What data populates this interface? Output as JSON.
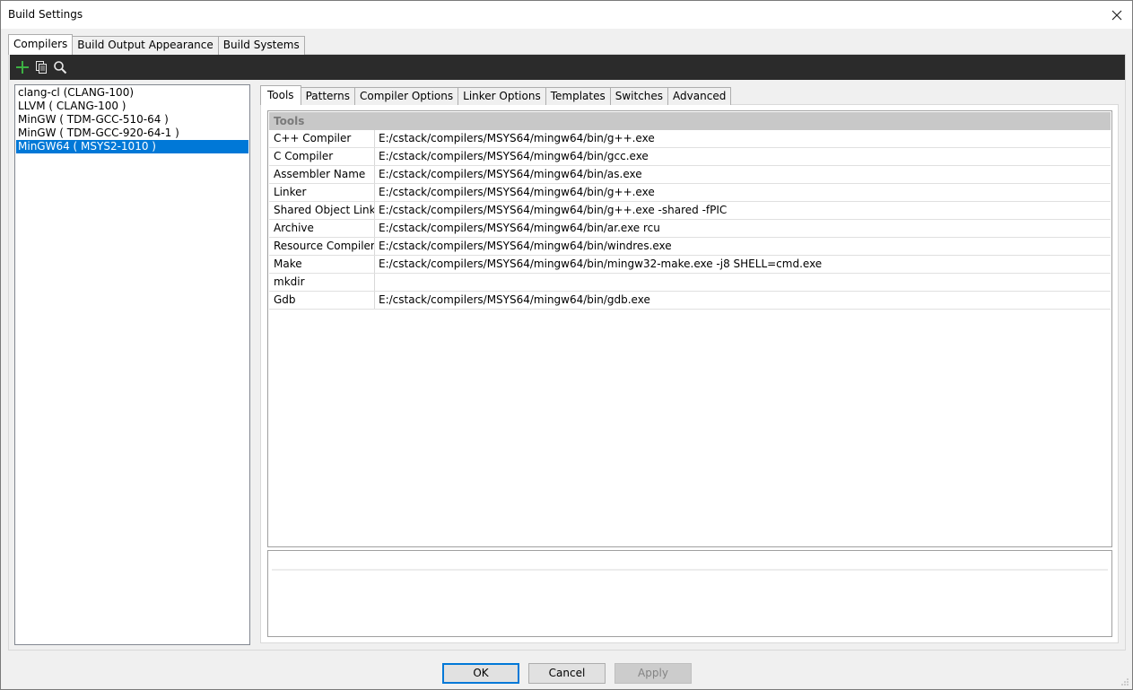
{
  "window": {
    "title": "Build Settings"
  },
  "top_tabs": [
    {
      "label": "Compilers"
    },
    {
      "label": "Build Output Appearance"
    },
    {
      "label": "Build Systems"
    }
  ],
  "toolbar": {
    "icons": [
      "add-icon",
      "copy-icon",
      "search-icon"
    ],
    "add_color": "#3cb043"
  },
  "compilers": [
    {
      "label": "clang-cl (CLANG-100)"
    },
    {
      "label": "LLVM ( CLANG-100 )"
    },
    {
      "label": "MinGW ( TDM-GCC-510-64 )"
    },
    {
      "label": "MinGW ( TDM-GCC-920-64-1 )"
    },
    {
      "label": "MinGW64 ( MSYS2-1010 )"
    }
  ],
  "selected_compiler_index": 4,
  "inner_tabs": [
    {
      "label": "Tools"
    },
    {
      "label": "Patterns"
    },
    {
      "label": "Compiler Options"
    },
    {
      "label": "Linker Options"
    },
    {
      "label": "Templates"
    },
    {
      "label": "Switches"
    },
    {
      "label": "Advanced"
    }
  ],
  "tools": {
    "header": "Tools",
    "rows": [
      {
        "key": "C++ Compiler",
        "value": "E:/cstack/compilers/MSYS64/mingw64/bin/g++.exe"
      },
      {
        "key": "C Compiler",
        "value": "E:/cstack/compilers/MSYS64/mingw64/bin/gcc.exe"
      },
      {
        "key": "Assembler Name",
        "value": "E:/cstack/compilers/MSYS64/mingw64/bin/as.exe"
      },
      {
        "key": "Linker",
        "value": "E:/cstack/compilers/MSYS64/mingw64/bin/g++.exe"
      },
      {
        "key": "Shared Object Linker",
        "value": "E:/cstack/compilers/MSYS64/mingw64/bin/g++.exe -shared -fPIC"
      },
      {
        "key": "Archive",
        "value": "E:/cstack/compilers/MSYS64/mingw64/bin/ar.exe rcu"
      },
      {
        "key": "Resource Compiler",
        "value": "E:/cstack/compilers/MSYS64/mingw64/bin/windres.exe"
      },
      {
        "key": "Make",
        "value": "E:/cstack/compilers/MSYS64/mingw64/bin/mingw32-make.exe -j8 SHELL=cmd.exe"
      },
      {
        "key": "mkdir",
        "value": ""
      },
      {
        "key": "Gdb",
        "value": "E:/cstack/compilers/MSYS64/mingw64/bin/gdb.exe"
      }
    ]
  },
  "buttons": {
    "ok": "OK",
    "cancel": "Cancel",
    "apply": "Apply"
  },
  "colors": {
    "selection": "#0078d7",
    "toolbar_bg": "#2b2b2b"
  }
}
